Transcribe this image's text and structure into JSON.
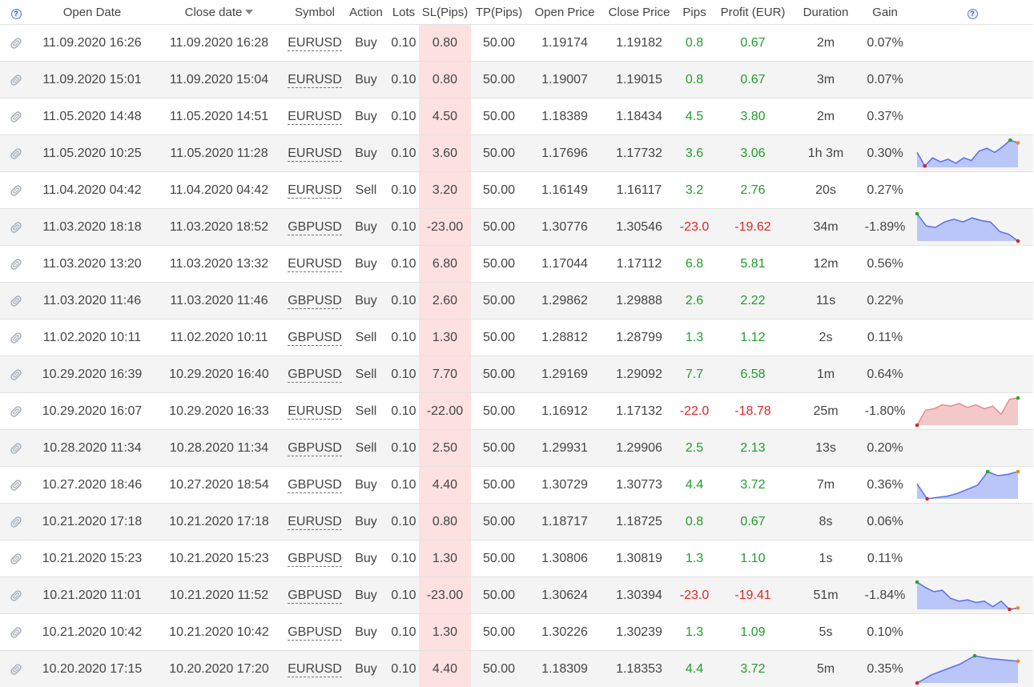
{
  "columns": [
    "",
    "Open Date",
    "Close date",
    "Symbol",
    "Action",
    "Lots",
    "SL(Pips)",
    "TP(Pips)",
    "Open Price",
    "Close Price",
    "Pips",
    "Profit (EUR)",
    "Duration",
    "Gain",
    ""
  ],
  "help_icon": "?",
  "colors": {
    "positive": "#1e9e2a",
    "negative": "#e0262a",
    "sl_highlight": "#fde0e0",
    "spark_fill_pos": "#b9c6f7",
    "spark_line_pos": "#5a6fe8",
    "spark_fill_neg": "#f3c8c8",
    "spark_line_neg": "#e88a8a"
  },
  "rows": [
    {
      "open": "11.09.2020 16:26",
      "close": "11.09.2020 16:28",
      "symbol": "EURUSD",
      "action": "Buy",
      "lots": "0.10",
      "sl": "0.80",
      "tp": "50.00",
      "open_price": "1.19174",
      "close_price": "1.19182",
      "pips": "0.8",
      "profit": "0.67",
      "duration": "2m",
      "gain": "0.07%",
      "positive": true,
      "spark": null
    },
    {
      "open": "11.09.2020 15:01",
      "close": "11.09.2020 15:04",
      "symbol": "EURUSD",
      "action": "Buy",
      "lots": "0.10",
      "sl": "0.80",
      "tp": "50.00",
      "open_price": "1.19007",
      "close_price": "1.19015",
      "pips": "0.8",
      "profit": "0.67",
      "duration": "3m",
      "gain": "0.07%",
      "positive": true,
      "spark": null
    },
    {
      "open": "11.05.2020 14:48",
      "close": "11.05.2020 14:51",
      "symbol": "EURUSD",
      "action": "Buy",
      "lots": "0.10",
      "sl": "4.50",
      "tp": "50.00",
      "open_price": "1.18389",
      "close_price": "1.18434",
      "pips": "4.5",
      "profit": "3.80",
      "duration": "2m",
      "gain": "0.37%",
      "positive": true,
      "spark": null
    },
    {
      "open": "11.05.2020 10:25",
      "close": "11.05.2020 11:28",
      "symbol": "EURUSD",
      "action": "Buy",
      "lots": "0.10",
      "sl": "3.60",
      "tp": "50.00",
      "open_price": "1.17696",
      "close_price": "1.17732",
      "pips": "3.6",
      "profit": "3.06",
      "duration": "1h 3m",
      "gain": "0.30%",
      "positive": true,
      "spark": [
        0.55,
        0.05,
        0.35,
        0.2,
        0.3,
        0.15,
        0.35,
        0.25,
        0.6,
        0.7,
        0.55,
        0.75,
        1.0,
        0.9
      ]
    },
    {
      "open": "11.04.2020 04:42",
      "close": "11.04.2020 04:42",
      "symbol": "EURUSD",
      "action": "Sell",
      "lots": "0.10",
      "sl": "3.20",
      "tp": "50.00",
      "open_price": "1.16149",
      "close_price": "1.16117",
      "pips": "3.2",
      "profit": "2.76",
      "duration": "20s",
      "gain": "0.27%",
      "positive": true,
      "spark": null
    },
    {
      "open": "11.03.2020 18:18",
      "close": "11.03.2020 18:52",
      "symbol": "GBPUSD",
      "action": "Buy",
      "lots": "0.10",
      "sl": "-23.00",
      "tp": "50.00",
      "open_price": "1.30776",
      "close_price": "1.30546",
      "pips": "-23.0",
      "profit": "-19.62",
      "duration": "34m",
      "gain": "-1.89%",
      "positive": false,
      "spark": [
        1.0,
        0.55,
        0.5,
        0.7,
        0.8,
        0.7,
        0.85,
        0.75,
        0.7,
        0.35,
        0.25,
        0.0
      ]
    },
    {
      "open": "11.03.2020 13:20",
      "close": "11.03.2020 13:32",
      "symbol": "EURUSD",
      "action": "Buy",
      "lots": "0.10",
      "sl": "6.80",
      "tp": "50.00",
      "open_price": "1.17044",
      "close_price": "1.17112",
      "pips": "6.8",
      "profit": "5.81",
      "duration": "12m",
      "gain": "0.56%",
      "positive": true,
      "spark": null
    },
    {
      "open": "11.03.2020 11:46",
      "close": "11.03.2020 11:46",
      "symbol": "GBPUSD",
      "action": "Buy",
      "lots": "0.10",
      "sl": "2.60",
      "tp": "50.00",
      "open_price": "1.29862",
      "close_price": "1.29888",
      "pips": "2.6",
      "profit": "2.22",
      "duration": "11s",
      "gain": "0.22%",
      "positive": true,
      "spark": null
    },
    {
      "open": "11.02.2020 10:11",
      "close": "11.02.2020 10:11",
      "symbol": "GBPUSD",
      "action": "Sell",
      "lots": "0.10",
      "sl": "1.30",
      "tp": "50.00",
      "open_price": "1.28812",
      "close_price": "1.28799",
      "pips": "1.3",
      "profit": "1.12",
      "duration": "2s",
      "gain": "0.11%",
      "positive": true,
      "spark": null
    },
    {
      "open": "10.29.2020 16:39",
      "close": "10.29.2020 16:40",
      "symbol": "GBPUSD",
      "action": "Sell",
      "lots": "0.10",
      "sl": "7.70",
      "tp": "50.00",
      "open_price": "1.29169",
      "close_price": "1.29092",
      "pips": "7.7",
      "profit": "6.58",
      "duration": "1m",
      "gain": "0.64%",
      "positive": true,
      "spark": null
    },
    {
      "open": "10.29.2020 16:07",
      "close": "10.29.2020 16:33",
      "symbol": "EURUSD",
      "action": "Sell",
      "lots": "0.10",
      "sl": "-22.00",
      "tp": "50.00",
      "open_price": "1.16912",
      "close_price": "1.17132",
      "pips": "-22.0",
      "profit": "-18.78",
      "duration": "25m",
      "gain": "-1.80%",
      "positive": false,
      "spark": [
        0.0,
        0.55,
        0.6,
        0.75,
        0.7,
        0.8,
        0.65,
        0.75,
        0.6,
        0.7,
        0.4,
        0.95,
        1.0
      ],
      "spark_neg": true
    },
    {
      "open": "10.28.2020 11:34",
      "close": "10.28.2020 11:34",
      "symbol": "GBPUSD",
      "action": "Sell",
      "lots": "0.10",
      "sl": "2.50",
      "tp": "50.00",
      "open_price": "1.29931",
      "close_price": "1.29906",
      "pips": "2.5",
      "profit": "2.13",
      "duration": "13s",
      "gain": "0.20%",
      "positive": true,
      "spark": null
    },
    {
      "open": "10.27.2020 18:46",
      "close": "10.27.2020 18:54",
      "symbol": "GBPUSD",
      "action": "Buy",
      "lots": "0.10",
      "sl": "4.40",
      "tp": "50.00",
      "open_price": "1.30729",
      "close_price": "1.30773",
      "pips": "4.4",
      "profit": "3.72",
      "duration": "7m",
      "gain": "0.36%",
      "positive": true,
      "spark": [
        0.55,
        0.0,
        0.05,
        0.1,
        0.2,
        0.35,
        0.5,
        1.0,
        0.85,
        0.9,
        1.0
      ]
    },
    {
      "open": "10.21.2020 17:18",
      "close": "10.21.2020 17:18",
      "symbol": "EURUSD",
      "action": "Buy",
      "lots": "0.10",
      "sl": "0.80",
      "tp": "50.00",
      "open_price": "1.18717",
      "close_price": "1.18725",
      "pips": "0.8",
      "profit": "0.67",
      "duration": "8s",
      "gain": "0.06%",
      "positive": true,
      "spark": null
    },
    {
      "open": "10.21.2020 15:23",
      "close": "10.21.2020 15:23",
      "symbol": "GBPUSD",
      "action": "Buy",
      "lots": "0.10",
      "sl": "1.30",
      "tp": "50.00",
      "open_price": "1.30806",
      "close_price": "1.30819",
      "pips": "1.3",
      "profit": "1.10",
      "duration": "1s",
      "gain": "0.11%",
      "positive": true,
      "spark": null
    },
    {
      "open": "10.21.2020 11:01",
      "close": "10.21.2020 11:52",
      "symbol": "GBPUSD",
      "action": "Buy",
      "lots": "0.10",
      "sl": "-23.00",
      "tp": "50.00",
      "open_price": "1.30624",
      "close_price": "1.30394",
      "pips": "-23.0",
      "profit": "-19.41",
      "duration": "51m",
      "gain": "-1.84%",
      "positive": false,
      "spark": [
        1.0,
        0.8,
        0.65,
        0.7,
        0.4,
        0.3,
        0.35,
        0.25,
        0.3,
        0.1,
        0.3,
        0.0,
        0.05
      ]
    },
    {
      "open": "10.21.2020 10:42",
      "close": "10.21.2020 10:42",
      "symbol": "GBPUSD",
      "action": "Buy",
      "lots": "0.10",
      "sl": "1.30",
      "tp": "50.00",
      "open_price": "1.30226",
      "close_price": "1.30239",
      "pips": "1.3",
      "profit": "1.09",
      "duration": "5s",
      "gain": "0.10%",
      "positive": true,
      "spark": null
    },
    {
      "open": "10.20.2020 17:15",
      "close": "10.20.2020 17:20",
      "symbol": "EURUSD",
      "action": "Buy",
      "lots": "0.10",
      "sl": "4.40",
      "tp": "50.00",
      "open_price": "1.18309",
      "close_price": "1.18353",
      "pips": "4.4",
      "profit": "3.72",
      "duration": "5m",
      "gain": "0.35%",
      "positive": true,
      "spark": [
        0.0,
        0.3,
        0.5,
        0.7,
        1.0,
        0.9,
        0.85,
        0.8
      ]
    }
  ]
}
